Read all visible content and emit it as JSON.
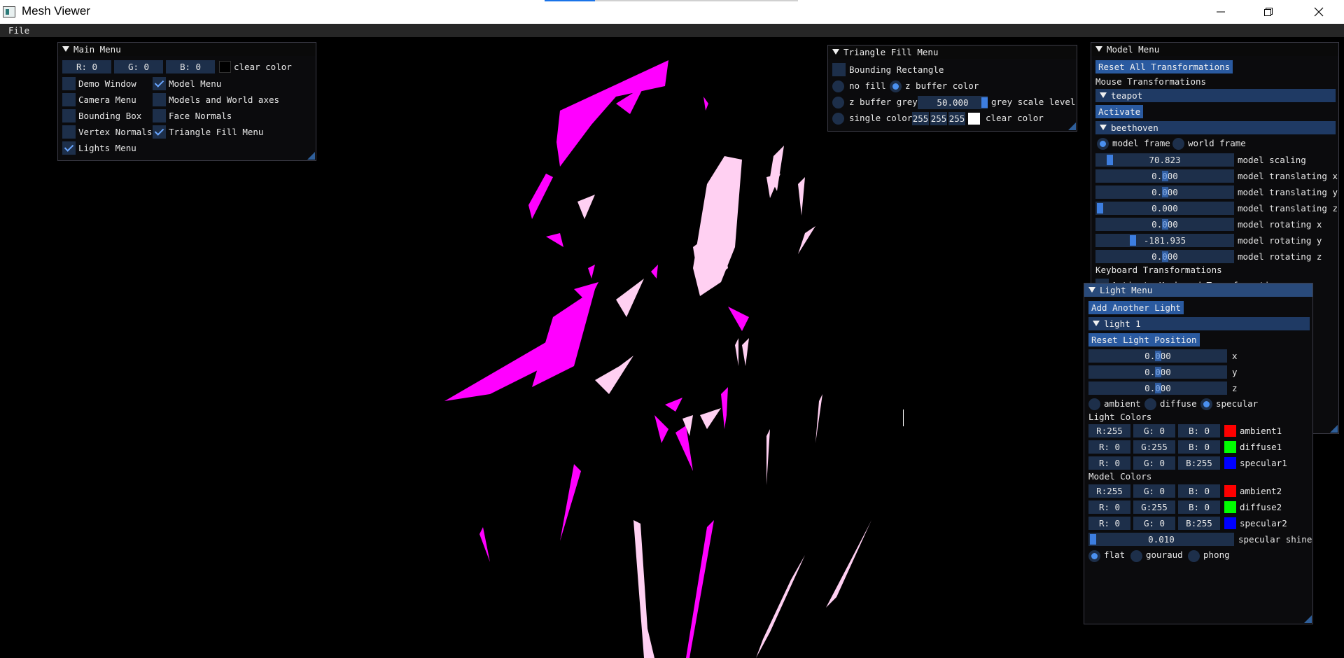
{
  "window": {
    "title": "Mesh Viewer"
  },
  "menubar": {
    "file": "File"
  },
  "main_menu": {
    "title": "Main Menu",
    "clear_color": {
      "r": "R:  0",
      "g": "G:  0",
      "b": "B:  0",
      "label": "clear color"
    },
    "items": [
      {
        "label": "Demo Window",
        "checked": false
      },
      {
        "label": "Model Menu",
        "checked": true
      },
      {
        "label": "Camera Menu",
        "checked": false
      },
      {
        "label": "Models and World axes",
        "checked": false
      },
      {
        "label": "Bounding Box",
        "checked": false
      },
      {
        "label": "Face Normals",
        "checked": false
      },
      {
        "label": "Vertex Normals",
        "checked": false
      },
      {
        "label": "Triangle Fill Menu",
        "checked": true
      },
      {
        "label": "Lights Menu",
        "checked": true
      }
    ]
  },
  "triangle_fill_menu": {
    "title": "Triangle Fill Menu",
    "bounding_rectangle": "Bounding Rectangle",
    "no_fill": "no fill",
    "z_buffer_color": "z buffer color",
    "z_buffer_grey": "z buffer grey",
    "grey_value": "50.000",
    "grey_scale_level": "grey scale level",
    "single_color": "single color",
    "rgb": [
      "255",
      "255",
      "255"
    ],
    "clear_color": "clear color"
  },
  "model_menu": {
    "title": "Model Menu",
    "reset_all": "Reset All Transformations",
    "mouse_transformations": "Mouse Transformations",
    "models": [
      "teapot",
      "beethoven"
    ],
    "activate": "Activate",
    "model_frame": "model frame",
    "world_frame": "world frame",
    "sliders": [
      {
        "value": "70.823",
        "label": "model scaling",
        "level": 0.05
      },
      {
        "value": "0.000",
        "label": "model translating x",
        "level": 0.5
      },
      {
        "value": "0.000",
        "label": "model translating y",
        "level": 0.5
      },
      {
        "value": "0.000",
        "label": "model translating z",
        "level": 0.0
      },
      {
        "value": "0.000",
        "label": "model rotating x",
        "level": 0.5
      },
      {
        "value": "-181.935",
        "label": "model rotating y",
        "level": 0.25
      },
      {
        "value": "0.000",
        "label": "model rotating z",
        "level": 0.5
      }
    ],
    "keyboard_transformations": "Keyboard Transformations",
    "activate_keyboard": "Activate Keyboard Transformations"
  },
  "light_menu": {
    "title": "Light Menu",
    "add_light": "Add Another Light",
    "light_name": "light 1",
    "reset_position": "Reset Light Position",
    "position": [
      {
        "value": "0.000",
        "axis": "x"
      },
      {
        "value": "0.000",
        "axis": "y"
      },
      {
        "value": "0.000",
        "axis": "z"
      }
    ],
    "modes": [
      "ambient",
      "diffuse",
      "specular"
    ],
    "light_colors_label": "Light Colors",
    "light_colors": [
      {
        "r": "R:255",
        "g": "G:  0",
        "b": "B:  0",
        "color": "#ff0000",
        "name": "ambient1"
      },
      {
        "r": "R:  0",
        "g": "G:255",
        "b": "B:  0",
        "color": "#00ff00",
        "name": "diffuse1"
      },
      {
        "r": "R:  0",
        "g": "G:  0",
        "b": "B:255",
        "color": "#0000ff",
        "name": "specular1"
      }
    ],
    "model_colors_label": "Model Colors",
    "model_colors": [
      {
        "r": "R:255",
        "g": "G:  0",
        "b": "B:  0",
        "color": "#ff0000",
        "name": "ambient2"
      },
      {
        "r": "R:  0",
        "g": "G:255",
        "b": "B:  0",
        "color": "#00ff00",
        "name": "diffuse2"
      },
      {
        "r": "R:  0",
        "g": "G:  0",
        "b": "B:255",
        "color": "#0000ff",
        "name": "specular2"
      }
    ],
    "shine_value": "0.010",
    "shine_label": "specular shine",
    "shading": [
      "flat",
      "gouraud",
      "phong"
    ]
  },
  "colors": {
    "accent": "#4a90f0",
    "frame_bg": "#1d2f4a",
    "magenta": "#ff00ff",
    "pink": "#ffc8f0"
  }
}
